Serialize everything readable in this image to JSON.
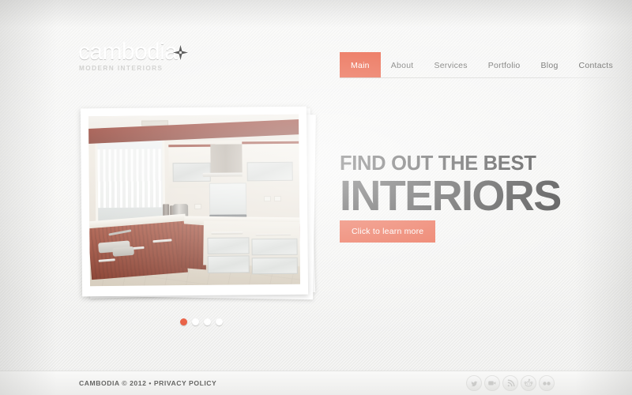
{
  "site": {
    "logo": {
      "name": "cambodia",
      "tagline": "MODERN INTERIORS",
      "icon": "sparkle-star-icon"
    },
    "accent_color": "#e8593c",
    "background_color": "#f1f1f0",
    "heading_color": "#3a3a3a"
  },
  "nav": {
    "items": [
      {
        "label": "Main",
        "active": true
      },
      {
        "label": "About",
        "active": false
      },
      {
        "label": "Services",
        "active": false
      },
      {
        "label": "Portfolio",
        "active": false
      },
      {
        "label": "Blog",
        "active": false
      },
      {
        "label": "Contacts",
        "active": false
      }
    ]
  },
  "hero": {
    "line1": "FIND OUT THE BEST",
    "line2": "INTERIORS",
    "cta_label": "Click to learn more",
    "slide_image_alt": "Modern kitchen interior with wood cabinets, frosted glass drawers and a curtained window",
    "slider_dots": [
      {
        "active": true
      },
      {
        "active": false
      },
      {
        "active": false
      },
      {
        "active": false
      }
    ]
  },
  "footer": {
    "copyright": "CAMBODIA © 2012 • PRIVACY POLICY",
    "social": [
      {
        "name": "twitter-icon",
        "title": "Twitter"
      },
      {
        "name": "youtube-icon",
        "title": "YouTube"
      },
      {
        "name": "rss-icon",
        "title": "RSS"
      },
      {
        "name": "reddit-icon",
        "title": "Reddit"
      },
      {
        "name": "flickr-icon",
        "title": "Flickr"
      }
    ]
  }
}
